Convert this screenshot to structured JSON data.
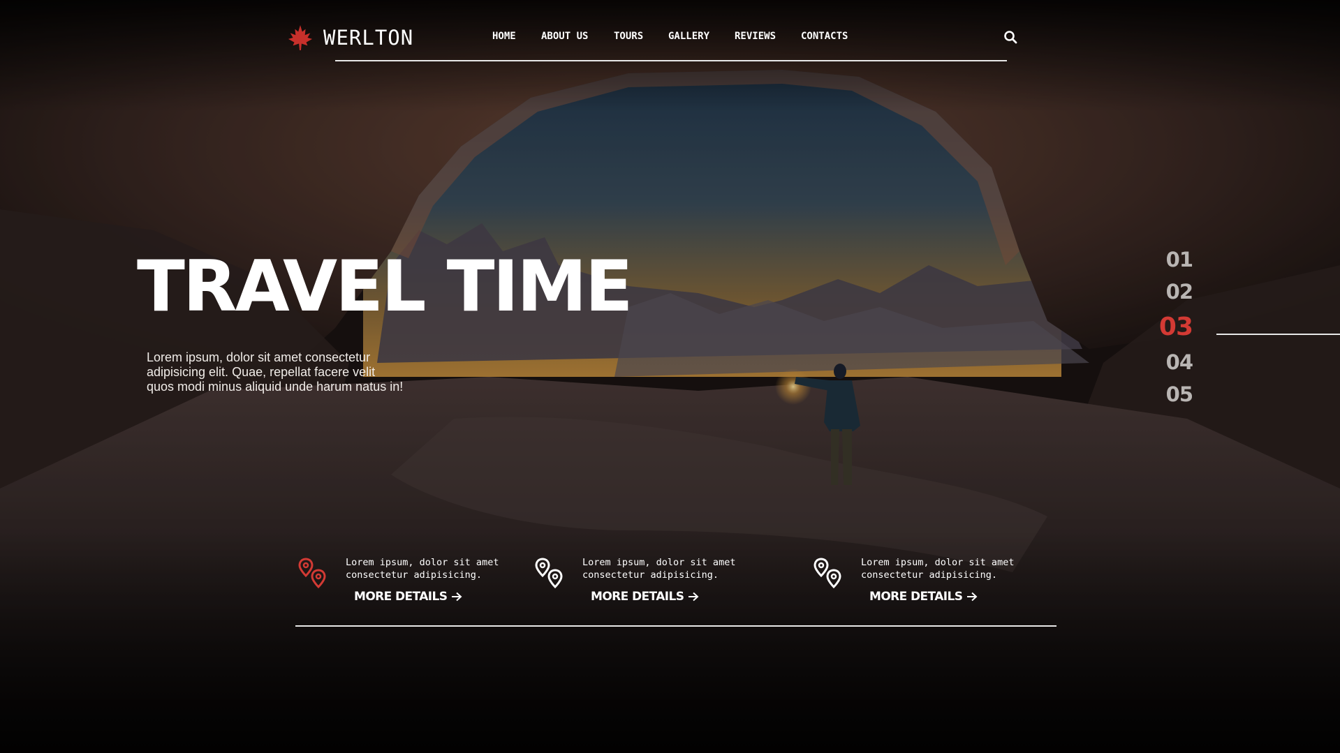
{
  "brand": {
    "name": "WERLTON",
    "icon": "maple-leaf-icon",
    "accent_color": "#d33a34"
  },
  "nav": {
    "items": [
      {
        "label": "HOME"
      },
      {
        "label": "ABOUT US"
      },
      {
        "label": "TOURS"
      },
      {
        "label": "GALLERY"
      },
      {
        "label": "REVIEWS"
      },
      {
        "label": "CONTACTS"
      }
    ],
    "search_icon": "search-icon"
  },
  "hero": {
    "title": "TRAVEL TIME",
    "description": "Lorem ipsum, dolor sit amet consectetur adipisicing elit. Quae, repellat facere velit quos modi minus aliquid unde harum natus in!"
  },
  "slides": {
    "items": [
      "01",
      "02",
      "03",
      "04",
      "05"
    ],
    "active": "03",
    "active_color": "#d33a34",
    "inactive_color": "#b9b5b3"
  },
  "features": [
    {
      "text": "Lorem ipsum, dolor sit amet consectetur adipisicing.",
      "link": "MORE DETAILS",
      "icon": "location-pins-icon",
      "icon_color": "#d33a34"
    },
    {
      "text": "Lorem ipsum, dolor sit amet consectetur adipisicing.",
      "link": "MORE DETAILS",
      "icon": "location-pins-icon",
      "icon_color": "#ffffff"
    },
    {
      "text": "Lorem ipsum, dolor sit amet consectetur adipisicing.",
      "link": "MORE DETAILS",
      "icon": "location-pins-icon",
      "icon_color": "#ffffff"
    }
  ]
}
